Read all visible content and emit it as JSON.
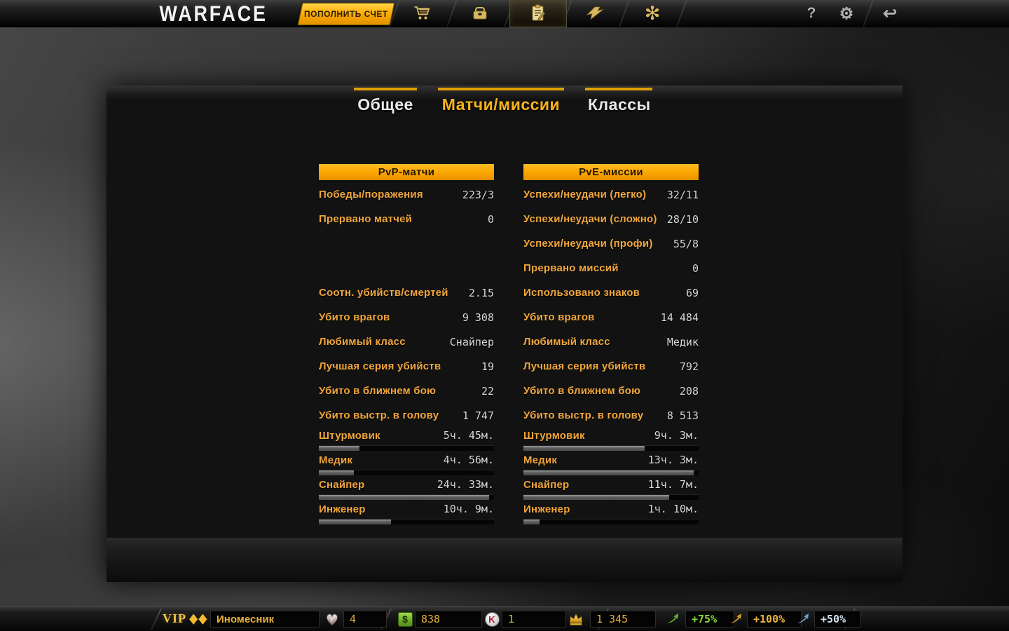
{
  "topbar": {
    "logo": "WARFACE",
    "topup_button": "ПОПОЛНИТЬ СЧЕТ",
    "help_glyph": "?",
    "settings_glyph": "⚙",
    "exit_glyph": "↩",
    "clan_flower_glyph": "✻"
  },
  "tabs": [
    {
      "label": "Общее",
      "active": false
    },
    {
      "label": "Матчи/миссии",
      "active": true
    },
    {
      "label": "Классы",
      "active": false
    }
  ],
  "stats": {
    "pvp": {
      "header": "PvP-матчи",
      "rows": [
        {
          "label": "Победы/поражения",
          "value": "223/3"
        },
        {
          "label": "Прервано матчей",
          "value": "0"
        },
        {
          "label": "",
          "value": ""
        },
        {
          "label": "",
          "value": ""
        },
        {
          "label": "Соотн. убийств/смертей",
          "value": "2.15"
        },
        {
          "label": "Убито врагов",
          "value": "9 308"
        },
        {
          "label": "Любимый класс",
          "value": "Снайпер"
        },
        {
          "label": "Лучшая серия убийств",
          "value": "19"
        },
        {
          "label": "Убито в ближнем бою",
          "value": "22"
        },
        {
          "label": "Убито выстр. в голову",
          "value": "1 747"
        }
      ],
      "classes": [
        {
          "label": "Штурмовик",
          "value": "5ч. 45м.",
          "percent": 23
        },
        {
          "label": "Медик",
          "value": "4ч. 56м.",
          "percent": 20
        },
        {
          "label": "Снайпер",
          "value": "24ч. 33м.",
          "percent": 97
        },
        {
          "label": "Инженер",
          "value": "10ч. 9м.",
          "percent": 41
        }
      ]
    },
    "pve": {
      "header": "PvE-миссии",
      "rows": [
        {
          "label": "Успехи/неудачи (легко)",
          "value": "32/11"
        },
        {
          "label": "Успехи/неудачи (сложно)",
          "value": "28/10"
        },
        {
          "label": "Успехи/неудачи (профи)",
          "value": "55/8"
        },
        {
          "label": "Прервано миссий",
          "value": "0"
        },
        {
          "label": "Использовано знаков",
          "value": "69"
        },
        {
          "label": "Убито врагов",
          "value": "14 484"
        },
        {
          "label": "Любимый класс",
          "value": "Медик"
        },
        {
          "label": "Лучшая серия убийств",
          "value": "792"
        },
        {
          "label": "Убито в ближнем бою",
          "value": "208"
        },
        {
          "label": "Убито выстр. в голову",
          "value": "8 513"
        }
      ],
      "classes": [
        {
          "label": "Штурмовик",
          "value": "9ч. 3м.",
          "percent": 69
        },
        {
          "label": "Медик",
          "value": "13ч. 3м.",
          "percent": 97
        },
        {
          "label": "Снайпер",
          "value": "11ч. 7м.",
          "percent": 83
        },
        {
          "label": "Инженер",
          "value": "1ч. 10м.",
          "percent": 9
        }
      ]
    }
  },
  "bottombar": {
    "vip_label": "VIP",
    "vip_diamonds": "◆◆",
    "player_name": "Иномесник",
    "badge_count": "4",
    "dollar_symbol": "$",
    "dollars": "838",
    "kredit_symbol": "K",
    "kredits": "1",
    "crowns": "1 345",
    "boosts": [
      {
        "name": "xp-boost",
        "value": "+75%",
        "color": "#86d83e"
      },
      {
        "name": "vip-boost",
        "value": "+100%",
        "color": "#edb33c"
      },
      {
        "name": "crown-boost",
        "value": "+50%",
        "color": "#cfe2f0"
      }
    ]
  },
  "colors": {
    "accent_gold": "#f7a600",
    "label_yellow": "#f0a63c",
    "value_white": "#d8d8d8",
    "bar_fill_gray": "#5c5c5c"
  }
}
